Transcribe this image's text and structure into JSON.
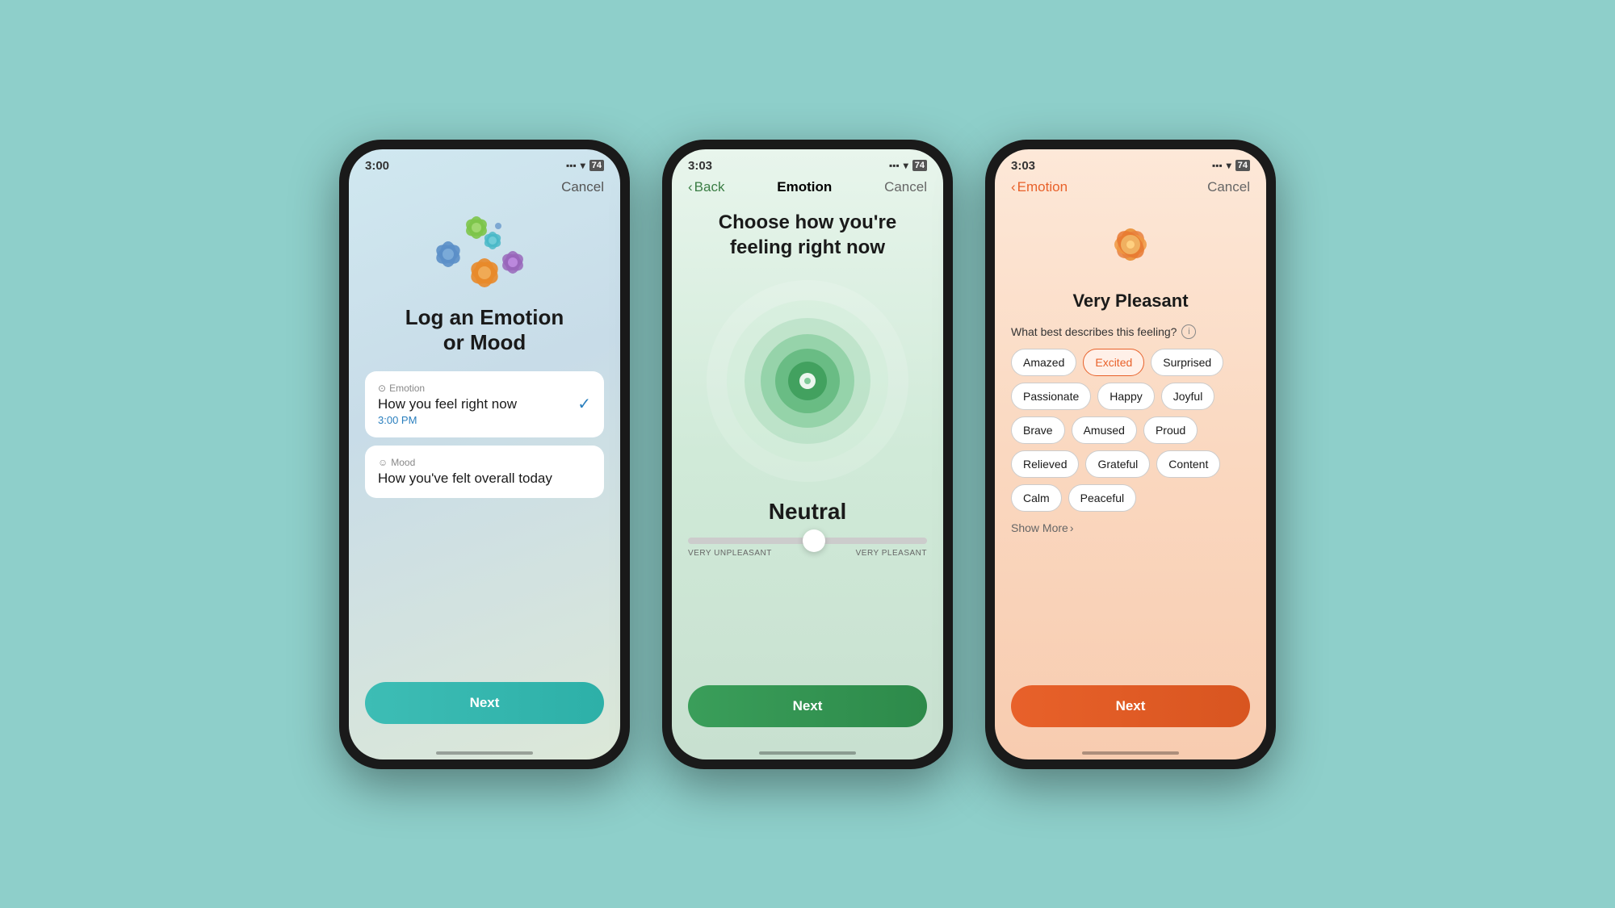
{
  "bg_color": "#8ecfca",
  "phone1": {
    "status_time": "3:00",
    "nav_cancel": "Cancel",
    "title_line1": "Log an Emotion",
    "title_line2": "or Mood",
    "option1": {
      "icon": "○",
      "label": "Emotion",
      "description": "How you feel right now",
      "time": "3:00 PM"
    },
    "option2": {
      "icon": "☺",
      "label": "Mood",
      "description": "How you've felt overall today"
    },
    "next_label": "Next"
  },
  "phone2": {
    "status_time": "3:03",
    "nav_back": "Back",
    "nav_title": "Emotion",
    "nav_cancel": "Cancel",
    "title": "Choose how you're feeling right now",
    "mood_label": "Neutral",
    "slider_left": "VERY UNPLEASANT",
    "slider_right": "VERY PLEASANT",
    "next_label": "Next"
  },
  "phone3": {
    "status_time": "3:03",
    "nav_back": "Emotion",
    "nav_cancel": "Cancel",
    "feeling_title": "Very Pleasant",
    "describe_label": "What best describes this feeling?",
    "tags": [
      {
        "label": "Amazed",
        "selected": false
      },
      {
        "label": "Excited",
        "selected": true
      },
      {
        "label": "Surprised",
        "selected": false
      },
      {
        "label": "Passionate",
        "selected": false
      },
      {
        "label": "Happy",
        "selected": false
      },
      {
        "label": "Joyful",
        "selected": false
      },
      {
        "label": "Brave",
        "selected": false
      },
      {
        "label": "Amused",
        "selected": false
      },
      {
        "label": "Proud",
        "selected": false
      },
      {
        "label": "Relieved",
        "selected": false
      },
      {
        "label": "Grateful",
        "selected": false
      },
      {
        "label": "Content",
        "selected": false
      },
      {
        "label": "Calm",
        "selected": false
      },
      {
        "label": "Peaceful",
        "selected": false
      }
    ],
    "show_more": "Show More",
    "next_label": "Next"
  }
}
